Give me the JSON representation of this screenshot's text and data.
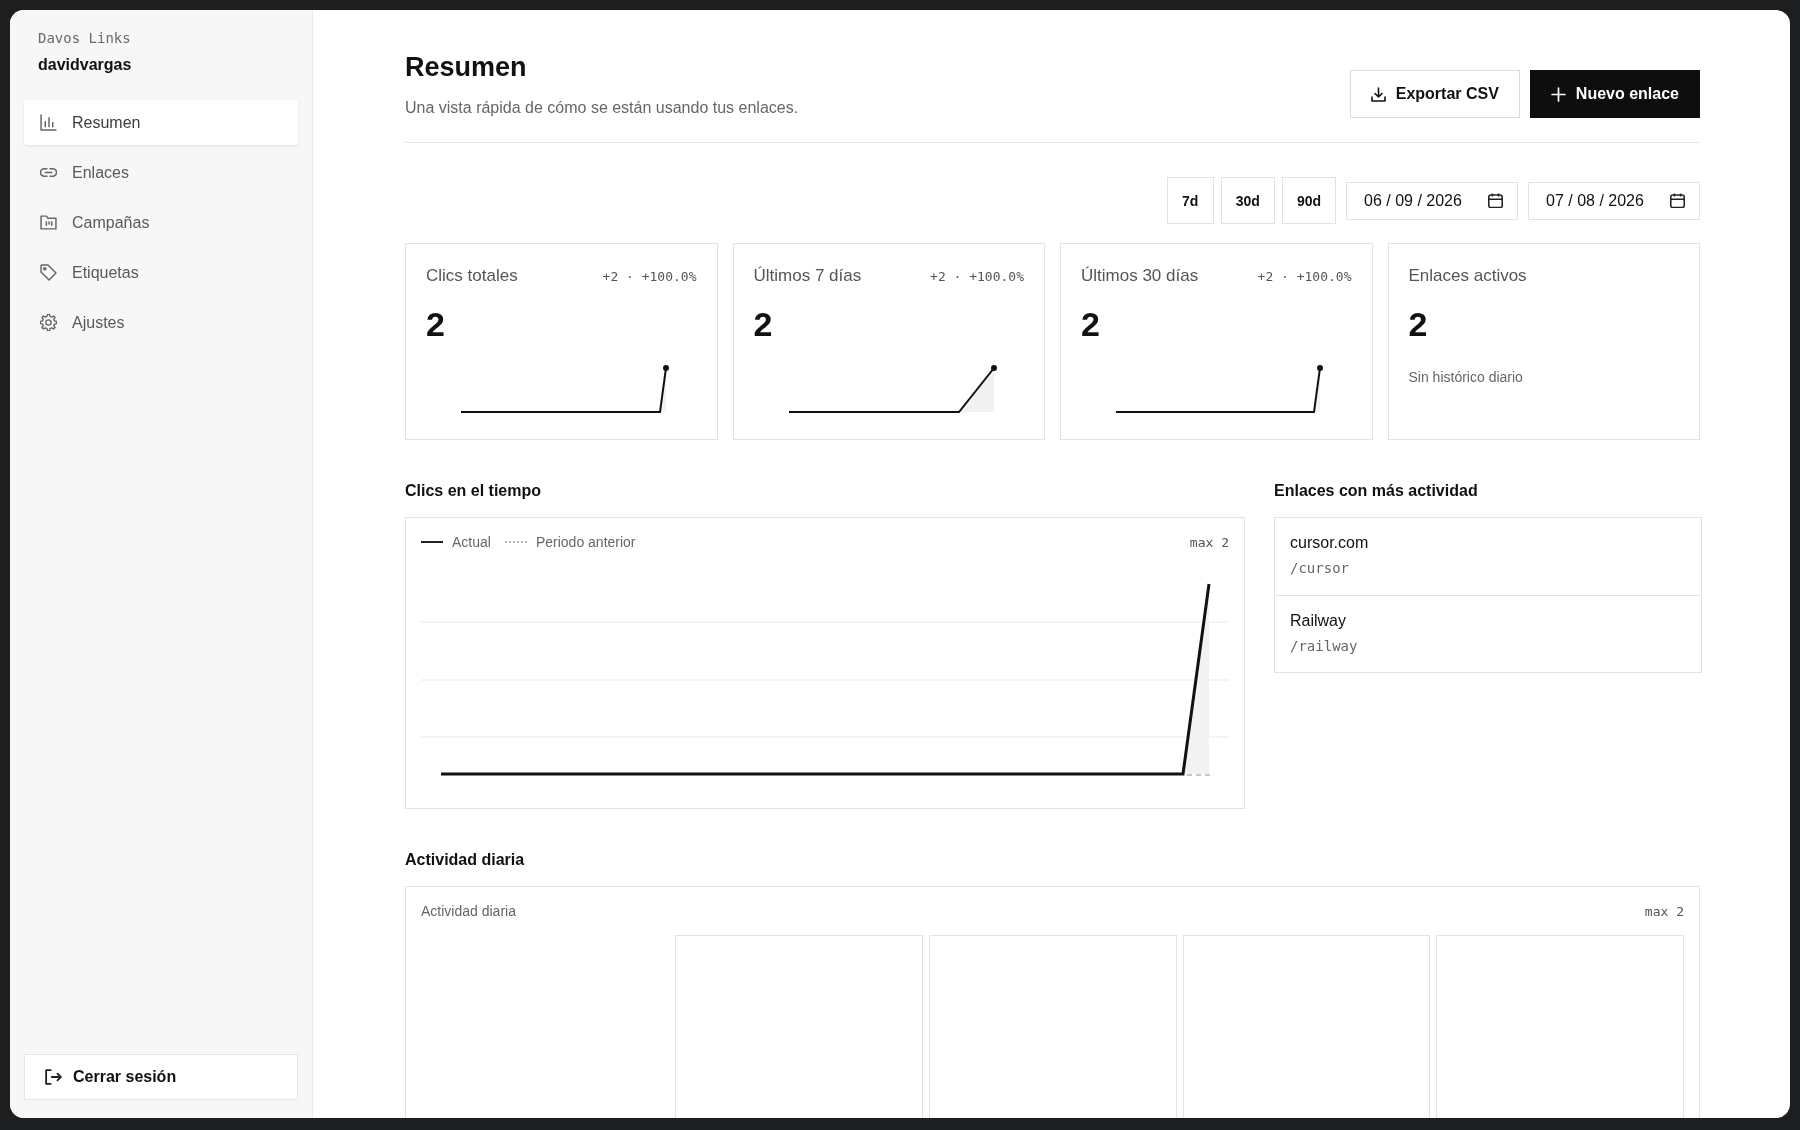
{
  "sidebar": {
    "brand": "Davos Links",
    "user": "davidvargas",
    "nav": [
      {
        "label": "Resumen",
        "selected": true
      },
      {
        "label": "Enlaces",
        "selected": false
      },
      {
        "label": "Campañas",
        "selected": false
      },
      {
        "label": "Etiquetas",
        "selected": false
      },
      {
        "label": "Ajustes",
        "selected": false
      }
    ],
    "logout": "Cerrar sesión"
  },
  "header": {
    "title": "Resumen",
    "subtitle": "Una vista rápida de cómo se están usando tus enlaces.",
    "actions": [
      {
        "label": "Exportar CSV",
        "kind": "secondary"
      },
      {
        "label": "Nuevo enlace",
        "kind": "primary"
      }
    ]
  },
  "filters": {
    "ranges": [
      {
        "label": "7d",
        "selected": false
      },
      {
        "label": "30d",
        "selected": false
      },
      {
        "label": "90d",
        "selected": false
      }
    ],
    "dates": [
      "06 / 09 / 2026",
      "07 / 08 / 2026"
    ]
  },
  "stats": [
    {
      "kind": "trend",
      "title": "Clics totales",
      "delta": "+2 · +100.0%",
      "value": "2"
    },
    {
      "kind": "trend",
      "title": "Últimos 7 días",
      "delta": "+2 · +100.0%",
      "value": "2"
    },
    {
      "kind": "trend",
      "title": "Últimos 30 días",
      "delta": "+2 · +100.0%",
      "value": "2"
    },
    {
      "kind": "note",
      "title": "Enlaces activos",
      "value": "2",
      "note": "Sin histórico diario"
    }
  ],
  "clicks_chart": {
    "title": "Clics en el tiempo",
    "legend": [
      {
        "label": "Actual",
        "kind": "solid"
      },
      {
        "label": "Periodo anterior",
        "kind": "dashed"
      }
    ],
    "max_label": "max 2"
  },
  "top_links": {
    "title": "Enlaces con más actividad",
    "items": [
      {
        "name": "cursor.com",
        "path": "/cursor"
      },
      {
        "name": "Railway",
        "path": "/railway"
      }
    ]
  },
  "daily_activity": {
    "title": "Actividad diaria",
    "label": "Actividad diaria",
    "max_label": "max 2"
  }
}
